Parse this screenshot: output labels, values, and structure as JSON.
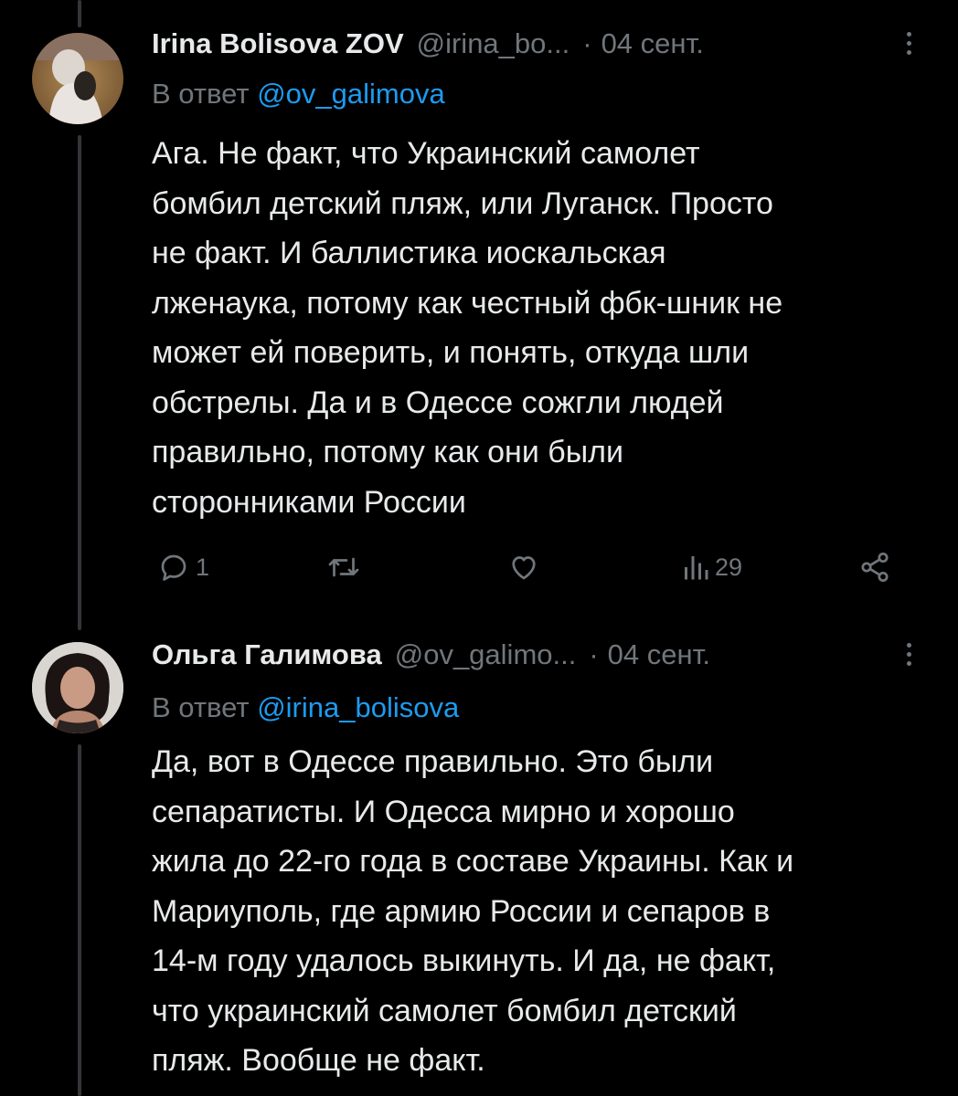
{
  "tweets": [
    {
      "author_name": "Irina Bolisova ZOV",
      "handle": "@irina_bo...",
      "separator": "·",
      "time": "04 сент.",
      "reply_prefix": "В ответ",
      "reply_to": "@ov_galimova",
      "body_lines": [
        "Ага. Не факт, что Украинский самолет",
        "бомбил детский пляж, или Луганск. Просто",
        "не факт. И баллистика иоскальская",
        "лженаука, потому как честный фбк-шник не",
        "может ей поверить, и понять, откуда шли",
        "обстрелы. Да и в Одессе сожгли людей",
        "правильно, потому как они были",
        "сторонниками России"
      ],
      "actions": {
        "reply_count": "1",
        "retweet_count": "",
        "like_count": "",
        "views_count": "29"
      },
      "icons": [
        "reply-icon",
        "retweet-icon",
        "like-icon",
        "views-icon",
        "share-icon",
        "more-icon"
      ]
    },
    {
      "author_name": "Ольга Галимова",
      "handle": "@ov_galimo...",
      "separator": "·",
      "time": "04 сент.",
      "reply_prefix": "В ответ",
      "reply_to": "@irina_bolisova",
      "body_lines": [
        "Да, вот в Одессе правильно. Это были",
        "сепаратисты. И Одесса мирно и хорошо",
        "жила до 22-го года в составе Украины. Как и",
        "Мариуполь, где армию России и сепаров в",
        "14-м году удалось выкинуть. И да, не факт,",
        "что украинский самолет бомбил детский",
        "пляж. Вообще не факт."
      ]
    }
  ],
  "colors": {
    "background": "#000000",
    "primary_text": "#e7e9ea",
    "secondary_text": "#71767b",
    "link": "#1d9bf0",
    "thread_line": "#333639"
  }
}
